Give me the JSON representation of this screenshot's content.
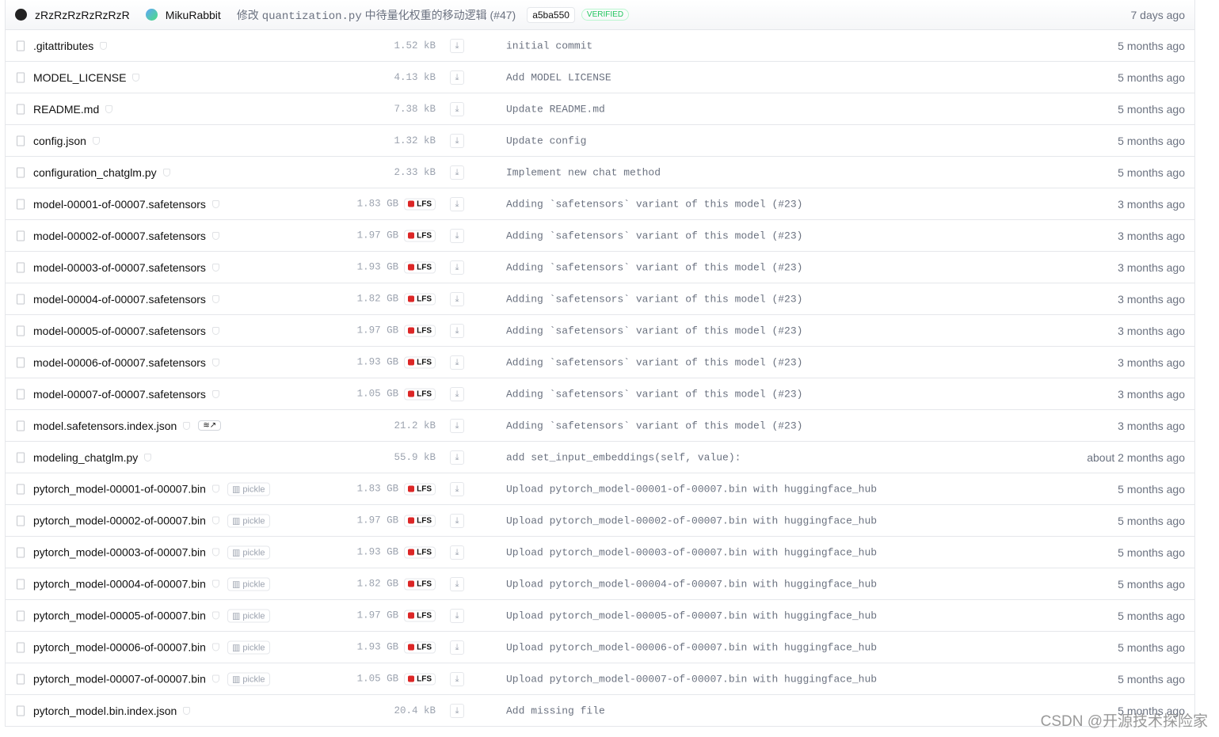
{
  "commit": {
    "author": "zRzRzRzRzRzRzR",
    "coauthor": "MikuRabbit",
    "msg_prefix": "修改",
    "msg_file": "quantization.py",
    "msg_suffix": "中待量化权重的移动逻辑 (#47)",
    "hash": "a5ba550",
    "verified": "VERIFIED",
    "date": "7 days ago"
  },
  "labels": {
    "lfs": "LFS",
    "pickle": "pickle",
    "download": "⤓"
  },
  "files": [
    {
      "name": ".gitattributes",
      "size": "1.52 kB",
      "msg": "initial commit",
      "date": "5 months ago"
    },
    {
      "name": "MODEL_LICENSE",
      "size": "4.13 kB",
      "msg": "Add MODEL LICENSE",
      "date": "5 months ago"
    },
    {
      "name": "README.md",
      "size": "7.38 kB",
      "msg": "Update README.md",
      "date": "5 months ago"
    },
    {
      "name": "config.json",
      "size": "1.32 kB",
      "msg": "Update config",
      "date": "5 months ago"
    },
    {
      "name": "configuration_chatglm.py",
      "size": "2.33 kB",
      "msg": "Implement new chat method",
      "date": "5 months ago"
    },
    {
      "name": "model-00001-of-00007.safetensors",
      "size": "1.83 GB",
      "lfs": true,
      "msg": "Adding `safetensors` variant of this model (#23)",
      "date": "3 months ago"
    },
    {
      "name": "model-00002-of-00007.safetensors",
      "size": "1.97 GB",
      "lfs": true,
      "msg": "Adding `safetensors` variant of this model (#23)",
      "date": "3 months ago"
    },
    {
      "name": "model-00003-of-00007.safetensors",
      "size": "1.93 GB",
      "lfs": true,
      "msg": "Adding `safetensors` variant of this model (#23)",
      "date": "3 months ago"
    },
    {
      "name": "model-00004-of-00007.safetensors",
      "size": "1.82 GB",
      "lfs": true,
      "msg": "Adding `safetensors` variant of this model (#23)",
      "date": "3 months ago"
    },
    {
      "name": "model-00005-of-00007.safetensors",
      "size": "1.97 GB",
      "lfs": true,
      "msg": "Adding `safetensors` variant of this model (#23)",
      "date": "3 months ago"
    },
    {
      "name": "model-00006-of-00007.safetensors",
      "size": "1.93 GB",
      "lfs": true,
      "msg": "Adding `safetensors` variant of this model (#23)",
      "date": "3 months ago"
    },
    {
      "name": "model-00007-of-00007.safetensors",
      "size": "1.05 GB",
      "lfs": true,
      "msg": "Adding `safetensors` variant of this model (#23)",
      "date": "3 months ago"
    },
    {
      "name": "model.safetensors.index.json",
      "size": "21.2 kB",
      "viewer": "≋↗",
      "msg": "Adding `safetensors` variant of this model (#23)",
      "date": "3 months ago"
    },
    {
      "name": "modeling_chatglm.py",
      "size": "55.9 kB",
      "msg": "add set_input_embeddings(self, value):",
      "date": "about 2 months ago"
    },
    {
      "name": "pytorch_model-00001-of-00007.bin",
      "size": "1.83 GB",
      "lfs": true,
      "pickle": true,
      "msg": "Upload pytorch_model-00001-of-00007.bin with huggingface_hub",
      "date": "5 months ago"
    },
    {
      "name": "pytorch_model-00002-of-00007.bin",
      "size": "1.97 GB",
      "lfs": true,
      "pickle": true,
      "msg": "Upload pytorch_model-00002-of-00007.bin with huggingface_hub",
      "date": "5 months ago"
    },
    {
      "name": "pytorch_model-00003-of-00007.bin",
      "size": "1.93 GB",
      "lfs": true,
      "pickle": true,
      "msg": "Upload pytorch_model-00003-of-00007.bin with huggingface_hub",
      "date": "5 months ago"
    },
    {
      "name": "pytorch_model-00004-of-00007.bin",
      "size": "1.82 GB",
      "lfs": true,
      "pickle": true,
      "msg": "Upload pytorch_model-00004-of-00007.bin with huggingface_hub",
      "date": "5 months ago"
    },
    {
      "name": "pytorch_model-00005-of-00007.bin",
      "size": "1.97 GB",
      "lfs": true,
      "pickle": true,
      "msg": "Upload pytorch_model-00005-of-00007.bin with huggingface_hub",
      "date": "5 months ago"
    },
    {
      "name": "pytorch_model-00006-of-00007.bin",
      "size": "1.93 GB",
      "lfs": true,
      "pickle": true,
      "msg": "Upload pytorch_model-00006-of-00007.bin with huggingface_hub",
      "date": "5 months ago"
    },
    {
      "name": "pytorch_model-00007-of-00007.bin",
      "size": "1.05 GB",
      "lfs": true,
      "pickle": true,
      "msg": "Upload pytorch_model-00007-of-00007.bin with huggingface_hub",
      "date": "5 months ago"
    },
    {
      "name": "pytorch_model.bin.index.json",
      "size": "20.4 kB",
      "msg": "Add missing file",
      "date": "5 months ago"
    }
  ],
  "watermark": "CSDN @开源技术探险家"
}
